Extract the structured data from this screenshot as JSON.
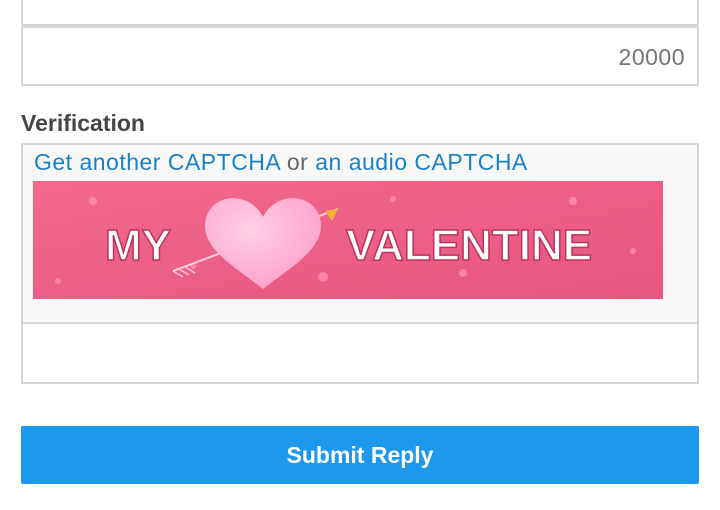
{
  "form": {
    "amount_value": "20000",
    "verification_label": "Verification",
    "captcha": {
      "link_new": "Get another CAPTCHA",
      "separator": "or",
      "link_audio": "an audio CAPTCHA",
      "image_text_left": "MY",
      "image_text_right": "VALENTINE"
    },
    "submit_label": "Submit Reply"
  },
  "colors": {
    "link": "#1a80c8",
    "button": "#1d98ec",
    "captcha_bg": "#ec5f86",
    "heart": "#ffb3d6"
  }
}
